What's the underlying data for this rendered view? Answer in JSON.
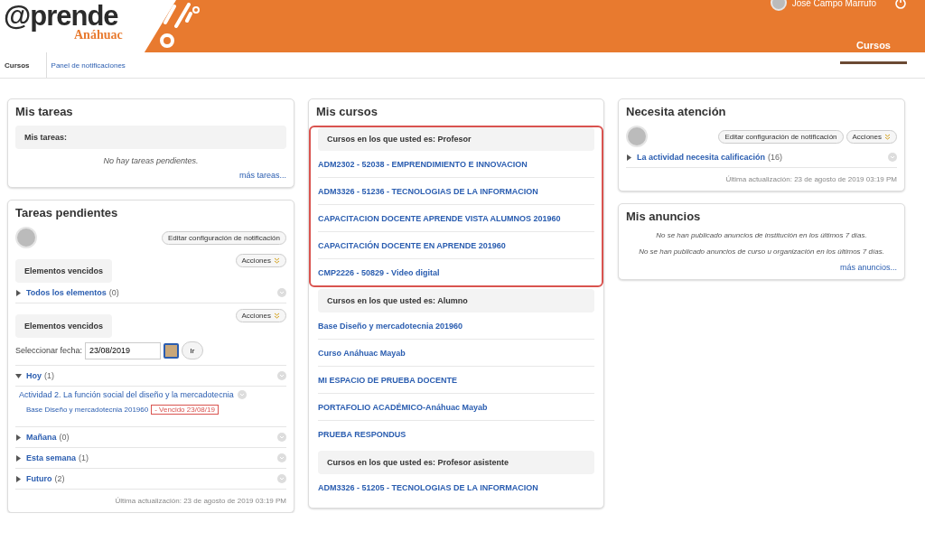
{
  "header": {
    "logo_main": "@prende",
    "logo_sub": "Anáhuac",
    "user": "José Campo Marrufo",
    "tabs": [
      {
        "label": "Cursos",
        "selected": true
      }
    ]
  },
  "subnav": [
    {
      "label": "Cursos",
      "selected": true
    },
    {
      "label": "Panel de notificaciones",
      "selected": false
    }
  ],
  "mis_tareas": {
    "title": "Mis tareas",
    "subheader": "Mis tareas:",
    "empty": "No hay tareas pendientes.",
    "more": "más tareas..."
  },
  "tareas_pendientes": {
    "title": "Tareas pendientes",
    "edit_button": "Editar configuración de notificación",
    "sections": [
      {
        "actions": "Acciones",
        "heading": "Elementos vencidos",
        "items": [
          {
            "label": "Todos los elementos",
            "count": "(0)",
            "expanded": false
          }
        ]
      },
      {
        "actions": "Acciones",
        "heading": "Elementos vencidos",
        "date_label": "Seleccionar fecha:",
        "date_value": "23/08/2019",
        "go_button": "Ir",
        "items": [
          {
            "label": "Hoy",
            "count": "(1)",
            "expanded": true,
            "children": [
              {
                "title": "Actividad 2. La función social del diseño y la mercadotecnia",
                "course": "Base Diseño y mercadotecnia 201960",
                "status": "- Vencido 23/08/19"
              }
            ]
          },
          {
            "label": "Mañana",
            "count": "(0)",
            "expanded": false
          },
          {
            "label": "Esta semana",
            "count": "(1)",
            "expanded": false
          },
          {
            "label": "Futuro",
            "count": "(2)",
            "expanded": false
          }
        ]
      }
    ],
    "updated": "Última actualización: 23 de agosto de 2019 03:19 PM"
  },
  "mis_cursos": {
    "title": "Mis cursos",
    "groups": [
      {
        "heading": "Cursos en los que usted es: Profesor",
        "highlighted": true,
        "courses": [
          "ADM2302 - 52038 - EMPRENDIMIENTO E INNOVACION",
          "ADM3326 - 51236 - TECNOLOGIAS DE LA INFORMACION",
          "CAPACITACION DOCENTE APRENDE VISTA ALUMNOS 201960",
          "CAPACITACIÓN DOCENTE EN APRENDE 201960",
          "CMP2226 - 50829 - Video digital"
        ]
      },
      {
        "heading": "Cursos en los que usted es: Alumno",
        "highlighted": false,
        "courses": [
          "Base Diseño y mercadotecnia 201960",
          "Curso Anáhuac Mayab",
          "MI ESPACIO DE PRUEBA DOCENTE",
          "PORTAFOLIO ACADÉMICO-Anáhuac Mayab",
          "PRUEBA RESPONDUS"
        ]
      },
      {
        "heading": "Cursos en los que usted es: Profesor asistente",
        "highlighted": false,
        "courses": [
          "ADM3326 - 51205 - TECNOLOGIAS DE LA INFORMACION"
        ]
      }
    ]
  },
  "necesita_atencion": {
    "title": "Necesita atención",
    "edit_button": "Editar configuración de notificación",
    "actions": "Acciones",
    "items": [
      {
        "label": "La actividad necesita calificación",
        "count": "(16)",
        "expanded": false
      }
    ],
    "updated": "Última actualización: 23 de agosto de 2019 03:19 PM"
  },
  "mis_anuncios": {
    "title": "Mis anuncios",
    "messages": [
      "No se han publicado anuncios de institución en los últimos 7 días.",
      "No se han publicado anuncios de curso u organización en los últimos 7 días."
    ],
    "more": "más anuncios..."
  }
}
